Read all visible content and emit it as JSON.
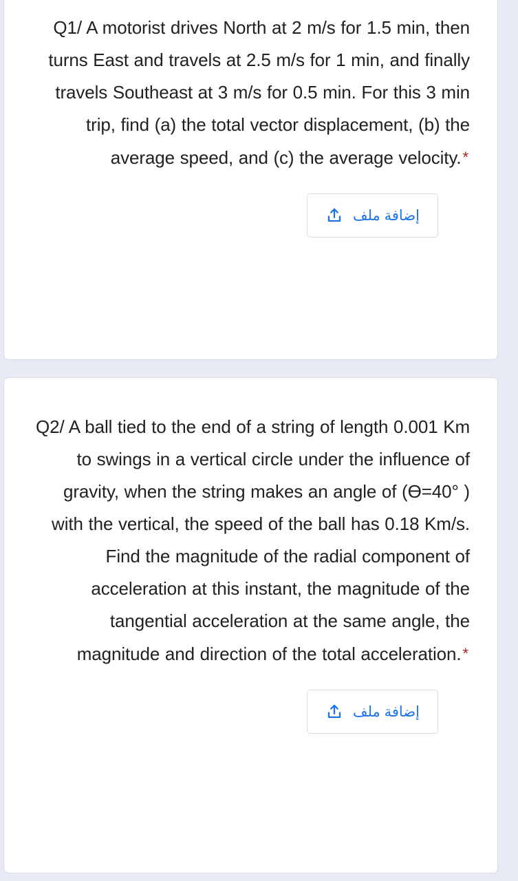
{
  "form": {
    "background_color": "#e8eaf6",
    "card_background": "#ffffff",
    "required_marker_color": "#a52714",
    "accent_color": "#1a73e8",
    "questions": [
      {
        "id": "q1",
        "text": "Q1/ A motorist drives North at 2 m/s for 1.5 min, then turns East and travels at 2.5 m/s for 1 min, and finally travels Southeast at 3 m/s for 0.5 min. For this 3 min trip, find (a) the total vector displacement, (b) the average speed, and (c) the average velocity.",
        "required_marker": "*",
        "upload_button": {
          "label": "إضافة ملف",
          "icon": "upload-icon"
        }
      },
      {
        "id": "q2",
        "text": "Q2/ A ball tied to the end of a string of length 0.001 Km to swings in a vertical circle under the influence of gravity, when the string makes an angle of (Ө=40° ) with the vertical, the speed of the ball has 0.18 Km/s. Find the magnitude of the radial component of acceleration at this instant, the magnitude of the tangential acceleration at the same angle, the magnitude and direction of the total acceleration.",
        "required_marker": "*",
        "upload_button": {
          "label": "إضافة ملف",
          "icon": "upload-icon"
        }
      }
    ]
  }
}
